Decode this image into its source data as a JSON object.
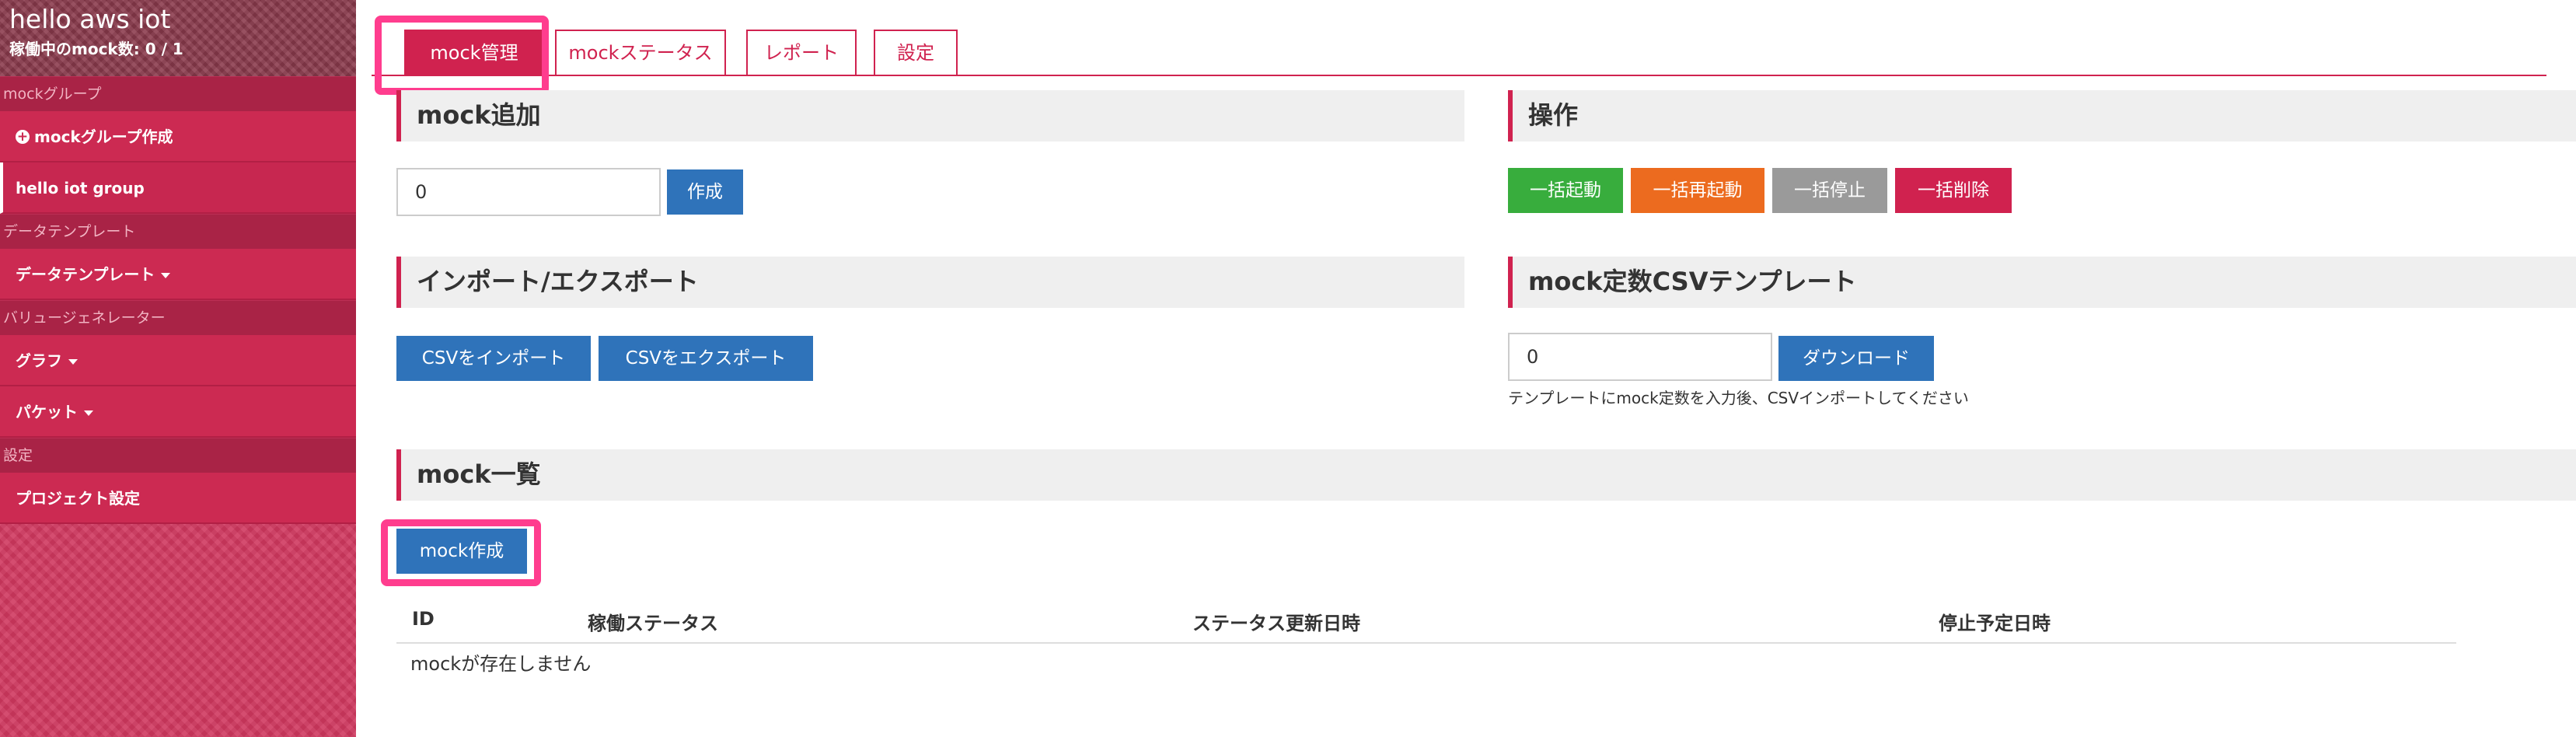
{
  "sidebar": {
    "app_title": "hello aws iot",
    "running_status": "稼働中のmock数: 0 / 1",
    "sections": {
      "mock_group": {
        "heading": "mockグループ",
        "create_label": "mockグループ作成",
        "group_item": "hello iot group"
      },
      "data_template": {
        "heading": "データテンプレート",
        "item": "データテンプレート"
      },
      "value_generator": {
        "heading": "バリュージェネレーター",
        "graph": "グラフ",
        "packet": "パケット"
      },
      "settings": {
        "heading": "設定",
        "project_settings": "プロジェクト設定"
      }
    }
  },
  "tabs": {
    "mock_management": "mock管理",
    "mock_status": "mockステータス",
    "report": "レポート",
    "settings": "設定",
    "active": "mock管理"
  },
  "mock_add": {
    "heading": "mock追加",
    "count_value": "0",
    "create_button": "作成"
  },
  "operations": {
    "heading": "操作",
    "start_all": "一括起動",
    "restart_all": "一括再起動",
    "stop_all": "一括停止",
    "delete_all": "一括削除"
  },
  "import_export": {
    "heading": "インポート/エクスポート",
    "import_button": "CSVをインポート",
    "export_button": "CSVをエクスポート"
  },
  "csv_template": {
    "heading": "mock定数CSVテンプレート",
    "count_value": "0",
    "download_button": "ダウンロード",
    "help": "テンプレートにmock定数を入力後、CSVインポートしてください"
  },
  "mock_list": {
    "heading": "mock一覧",
    "create_button": "mock作成",
    "columns": [
      "ID",
      "稼働ステータス",
      "ステータス更新日時",
      "停止予定日時"
    ],
    "empty_message": "mockが存在しません"
  },
  "colors": {
    "accent": "#d0224f",
    "sidebar": "#cc2a52",
    "primary_button": "#2f73ba",
    "success_button": "#38ad3d",
    "warning_button": "#ec6b1f",
    "muted_button": "#9a9a9a",
    "highlight": "#ff3d8e"
  },
  "icons": {
    "create_group": "plus-circle-icon",
    "dropdown": "caret-down-icon"
  }
}
